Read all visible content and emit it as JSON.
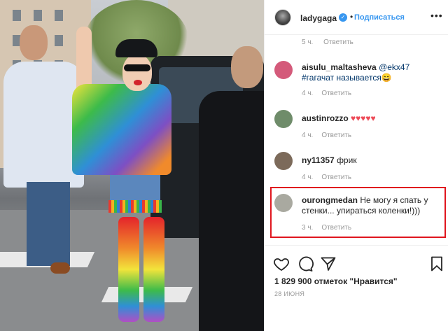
{
  "post": {
    "username": "ladygaga",
    "follow_label": "Подписаться",
    "separator": "•",
    "more_label": "•••"
  },
  "top_meta": {
    "time": "5 ч.",
    "reply": "Ответить"
  },
  "comments": [
    {
      "username": "aisulu_maltasheva",
      "mention": "@ekx47",
      "text": "#гагачат называется😄",
      "time": "4 ч.",
      "reply": "Ответить",
      "avatar_color": "#d45a7a"
    },
    {
      "username": "austinrozzo",
      "text": "♥♥♥♥♥",
      "time": "4 ч.",
      "reply": "Ответить",
      "avatar_color": "#6f8c6a"
    },
    {
      "username": "ny11357",
      "text": "фрик",
      "time": "4 ч.",
      "reply": "Ответить",
      "avatar_color": "#7c6a5a"
    },
    {
      "username": "ourongmedan",
      "text": "Не могу я спать у стенки... упираться коленки!)))",
      "time": "3 ч.",
      "reply": "Ответить",
      "avatar_color": "#a9a9a0"
    }
  ],
  "footer": {
    "likes": "1 829 900 отметок \"Нравится\"",
    "date": "28 июня"
  },
  "colors": {
    "accent": "#3897f0",
    "highlight_border": "#e0161e",
    "heart": "#ed4956"
  }
}
